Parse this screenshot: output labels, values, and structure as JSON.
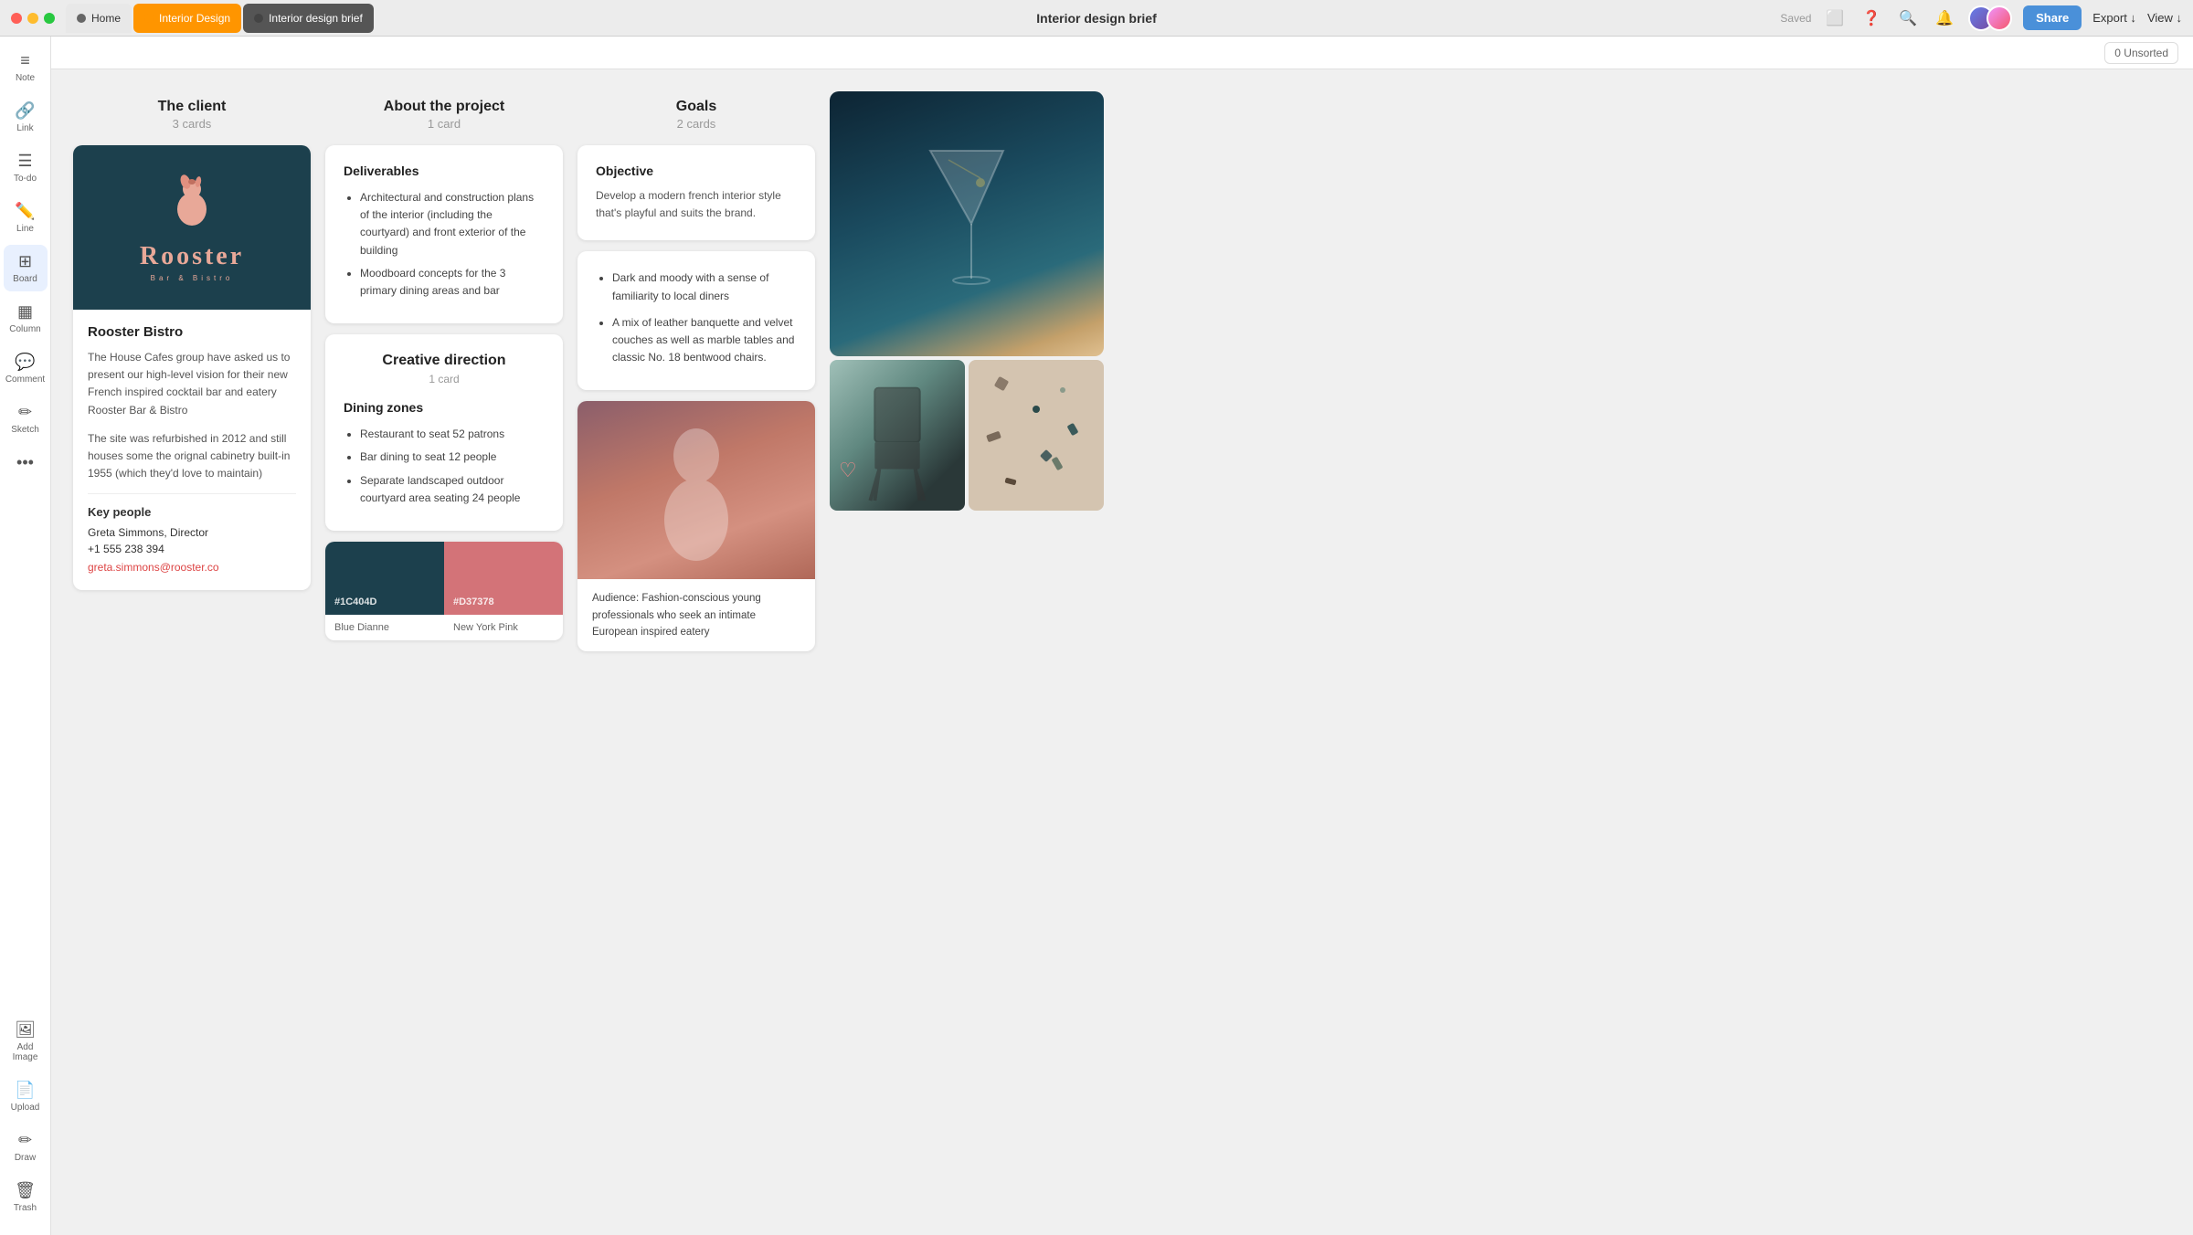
{
  "titlebar": {
    "home_tab": "Home",
    "interior_tab": "Interior Design",
    "brief_tab": "Interior design brief",
    "title": "Interior design brief",
    "saved": "Saved",
    "share_btn": "Share",
    "export_btn": "Export ↓",
    "view_btn": "View ↓",
    "unsorted": "0 Unsorted"
  },
  "sidebar": {
    "items": [
      {
        "id": "note",
        "icon": "≡",
        "label": "Note"
      },
      {
        "id": "link",
        "icon": "🔗",
        "label": "Link"
      },
      {
        "id": "todo",
        "icon": "☑",
        "label": "To-do"
      },
      {
        "id": "line",
        "icon": "✏",
        "label": "Line"
      },
      {
        "id": "board",
        "icon": "⊞",
        "label": "Board"
      },
      {
        "id": "column",
        "icon": "▦",
        "label": "Column"
      },
      {
        "id": "comment",
        "icon": "💬",
        "label": "Comment"
      },
      {
        "id": "sketch",
        "icon": "✏",
        "label": "Sketch"
      },
      {
        "id": "more",
        "icon": "•••",
        "label": ""
      },
      {
        "id": "addimage",
        "icon": "🖼",
        "label": "Add Image"
      },
      {
        "id": "upload",
        "icon": "📄",
        "label": "Upload"
      },
      {
        "id": "draw",
        "icon": "✏",
        "label": "Draw"
      }
    ],
    "trash": "Trash"
  },
  "columns": {
    "client": {
      "title": "The client",
      "count": "3 cards",
      "logo_top": "Rooster",
      "logo_sub": "Bar & Bistro",
      "client_name": "Rooster Bistro",
      "desc1": "The House Cafes group have asked us to present our high-level vision for their new French inspired cocktail bar and eatery Rooster Bar & Bistro",
      "desc2": "The site was refurbished in 2012 and still houses some the orignal cabinetry built-in 1955 (which they'd love to maintain)",
      "key_people_title": "Key people",
      "contact_name": "Greta Simmons, Director",
      "contact_phone": "+1 555 238 394",
      "contact_email": "greta.simmons@rooster.co"
    },
    "project": {
      "title": "About the project",
      "count": "1 card",
      "deliverables_title": "Deliverables",
      "deliverables": [
        "Architectural and construction plans of the interior (including the courtyard) and front exterior of the building",
        "Moodboard concepts for the 3 primary dining areas and bar"
      ],
      "creative_title": "Creative direction",
      "creative_count": "1 card",
      "dining_title": "Dining zones",
      "dining_items": [
        "Restaurant to seat 52 patrons",
        "Bar dining to seat 12 people",
        "Separate landscaped outdoor courtyard area seating 24 people"
      ],
      "swatch1_hex": "#1C404D",
      "swatch1_name": "Blue Dianne",
      "swatch2_hex": "#D37378",
      "swatch2_name": "New York Pink"
    },
    "goals": {
      "title": "Goals",
      "count": "2 cards",
      "objective_title": "Objective",
      "objective_desc": "Develop a modern french interior style that's playful and suits the brand.",
      "goals_list": [
        "Dark and moody with a sense of familiarity to local diners",
        "A mix of leather banquette and velvet couches as well as marble tables and classic No. 18 bentwood chairs."
      ],
      "audience_text": "Audience: Fashion-conscious young professionals who seek an intimate European inspired eatery"
    }
  }
}
